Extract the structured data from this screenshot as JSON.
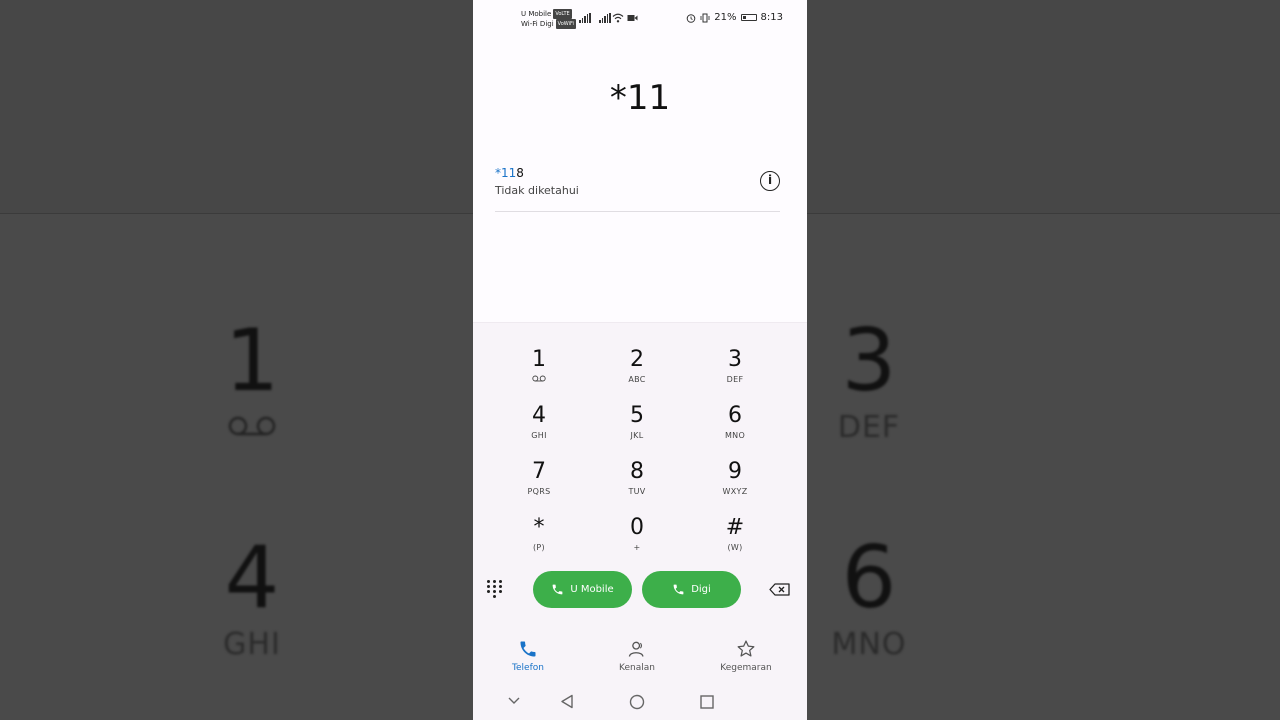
{
  "status_bar": {
    "carrier1": "U Mobile",
    "carrier1_tag": "VoLTE",
    "carrier2": "Wi-Fi Digi",
    "carrier2_tag": "VoWiFi",
    "battery_percent": "21%",
    "time": "8:13"
  },
  "dialer": {
    "number": "*11"
  },
  "suggestion": {
    "number_match": "*11",
    "number_rest": "8",
    "label": "Tidak diketahui"
  },
  "keypad": [
    {
      "digit": "1",
      "sub": "voicemail"
    },
    {
      "digit": "2",
      "sub": "ABC"
    },
    {
      "digit": "3",
      "sub": "DEF"
    },
    {
      "digit": "4",
      "sub": "GHI"
    },
    {
      "digit": "5",
      "sub": "JKL"
    },
    {
      "digit": "6",
      "sub": "MNO"
    },
    {
      "digit": "7",
      "sub": "PQRS"
    },
    {
      "digit": "8",
      "sub": "TUV"
    },
    {
      "digit": "9",
      "sub": "WXYZ"
    },
    {
      "digit": "*",
      "sub": "(P)"
    },
    {
      "digit": "0",
      "sub": "+"
    },
    {
      "digit": "#",
      "sub": "(W)"
    }
  ],
  "call_buttons": {
    "sim1_label": "U Mobile",
    "sim2_label": "Digi"
  },
  "nav": {
    "phone": "Telefon",
    "contacts": "Kenalan",
    "favorites": "Kegemaran"
  },
  "background": {
    "k1": "1",
    "k3": "3",
    "k3s": "DEF",
    "k4": "4",
    "k4s": "GHI",
    "k6": "6",
    "k6s": "MNO"
  },
  "colors": {
    "accent": "#1a73c8",
    "call_green": "#3daf4a"
  }
}
